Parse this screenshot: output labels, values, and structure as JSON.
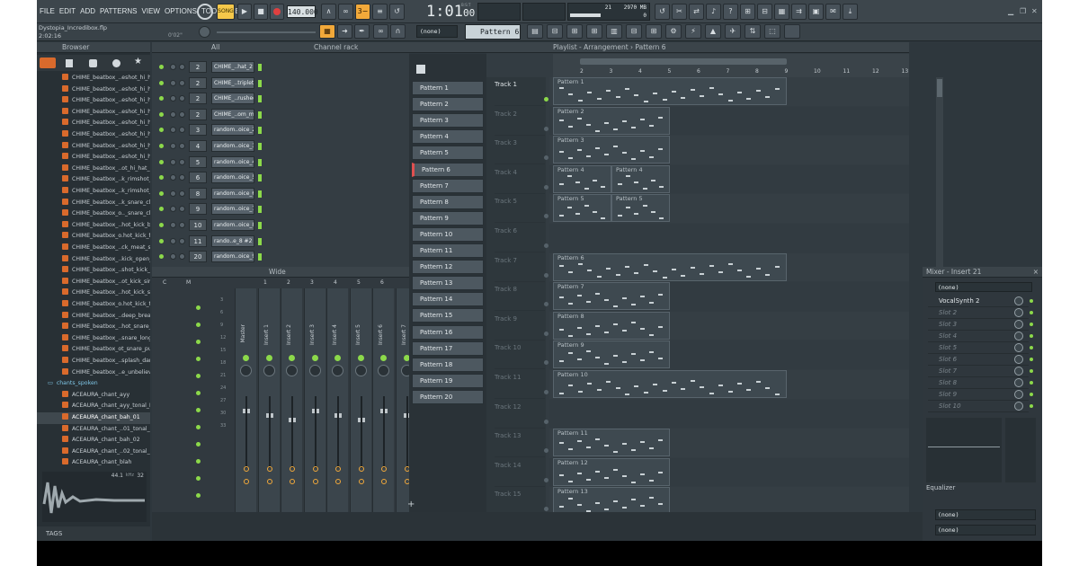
{
  "menu": [
    "FILE",
    "EDIT",
    "ADD",
    "PATTERNS",
    "VIEW",
    "OPTIONS",
    "TOOLS",
    "HELP"
  ],
  "transport": {
    "mode": "SONG",
    "tempo": "140.000",
    "time": "1:01",
    "time_ms": "00",
    "bst": "B:S:T"
  },
  "monitor": {
    "cpu": "21",
    "memory": "2970 MB",
    "voices": "0"
  },
  "project": {
    "file": "Dystopia_Incredibox.flp",
    "length": "2:02:16",
    "offset": "0'02\""
  },
  "toolbar": {
    "pattern_selector": "Pattern 6",
    "snap": "(none)"
  },
  "browser": {
    "title": "Browser",
    "filter": "All",
    "items": [
      "CHIME_beatbox_..eshot_hi_hat_1",
      "CHIME_beatbox_..eshot_hi_hat_2",
      "CHIME_beatbox_..eshot_hi_hat_3",
      "CHIME_beatbox_..eshot_hi_hat_4",
      "CHIME_beatbox_..eshot_hi_hat_5",
      "CHIME_beatbox_..eshot_hi_hat_6",
      "CHIME_beatbox_..eshot_hi_hat_7",
      "CHIME_beatbox_..eshot_hi_hat_8",
      "CHIME_beatbox_..ot_hi_hat_open",
      "CHIME_beatbox_..k_rimshot_airy",
      "CHIME_beatbox_..k_rimshot_wide",
      "CHIME_beatbox_..k_snare_clacky",
      "CHIME_beatbox_o.._snare_classic",
      "CHIME_beatbox_..hot_kick_breath",
      "CHIME_beatbox_o.hot_kick_fluffy",
      "CHIME_beatbox_..ck_meat_shield",
      "CHIME_beatbox_..kick_open_hat",
      "CHIME_beatbox_..shot_kick_shhh",
      "CHIME_beatbox_..ot_kick_simple",
      "CHIME_beatbox_..hot_kick_splash",
      "CHIME_beatbox_o.hot_kick_tight",
      "CHIME_beatbox_..deep_breathy",
      "CHIME_beatbox_..hot_snare_fizzy",
      "CHIME_beatbox_..snare_long_tail",
      "CHIME_beatbox_ot_snare_punch",
      "CHIME_beatbox_..splash_damage",
      "CHIME_beatbox_..e_unbelievable"
    ],
    "folder": "chants_spoken",
    "subitems": [
      "ACEAURA_chant_ayy",
      "ACEAURA_chant_ayy_tonal_Fmin",
      "ACEAURA_chant_bah_01",
      "ACEAURA_chant_..01_tonal_Fmin",
      "ACEAURA_chant_bah_02",
      "ACEAURA_chant_..02_tonal_Fmin",
      "ACEAURA_chant_blah"
    ],
    "selected_sub": 2,
    "sample_info": "44.1",
    "sample_khz": "kHz",
    "sample_bits": "32",
    "tags": "TAGS"
  },
  "channel_rack": {
    "title": "Channel rack",
    "filter": "All",
    "channels": [
      {
        "num": "2",
        "name": "CHIME_..hat_2"
      },
      {
        "num": "2",
        "name": "CHIME_..triplet"
      },
      {
        "num": "2",
        "name": "CHIME_..rushed"
      },
      {
        "num": "2",
        "name": "CHIME_..om_mid"
      },
      {
        "num": "3",
        "name": "random..oice_2"
      },
      {
        "num": "4",
        "name": "random..oice_3"
      },
      {
        "num": "5",
        "name": "random..oice_4"
      },
      {
        "num": "6",
        "name": "random..oice_5"
      },
      {
        "num": "8",
        "name": "random..oice_6"
      },
      {
        "num": "9",
        "name": "random..oice_7"
      },
      {
        "num": "10",
        "name": "random..oice_8"
      },
      {
        "num": "11",
        "name": "rando..e_8 #2"
      },
      {
        "num": "20",
        "name": "random..oice_9"
      }
    ]
  },
  "mixer": {
    "view": "Wide",
    "strips": [
      "C",
      "M",
      "1",
      "2",
      "3",
      "4",
      "5",
      "6"
    ],
    "channels": [
      "Master",
      "Insert 1",
      "Insert 2",
      "Insert 3",
      "Insert 4",
      "Insert 5",
      "Insert 6",
      "Insert 7"
    ],
    "scale": [
      "3",
      "6",
      "9",
      "12",
      "15",
      "18",
      "21",
      "24",
      "27",
      "30",
      "33"
    ]
  },
  "patterns": [
    "Pattern 1",
    "Pattern 2",
    "Pattern 3",
    "Pattern 4",
    "Pattern 5",
    "Pattern 6",
    "Pattern 7",
    "Pattern 8",
    "Pattern 9",
    "Pattern 10",
    "Pattern 11",
    "Pattern 12",
    "Pattern 13",
    "Pattern 14",
    "Pattern 15",
    "Pattern 16",
    "Pattern 17",
    "Pattern 18",
    "Pattern 19",
    "Pattern 20"
  ],
  "selected_pattern": 5,
  "playlist": {
    "title": "Playlist - Arrangement",
    "pattern": "Pattern 6",
    "bars": [
      "2",
      "3",
      "4",
      "5",
      "6",
      "7",
      "8",
      "9",
      "10",
      "11",
      "12",
      "13"
    ],
    "tracks": [
      "Track 1",
      "Track 2",
      "Track 3",
      "Track 4",
      "Track 5",
      "Track 6",
      "Track 7",
      "Track 8",
      "Track 9",
      "Track 10",
      "Track 11",
      "Track 12",
      "Track 13",
      "Track 14",
      "Track 15"
    ],
    "clips": [
      {
        "track": 0,
        "start": 1,
        "len": 8,
        "label": "Pattern 1"
      },
      {
        "track": 1,
        "start": 1,
        "len": 4,
        "label": "Pattern 2"
      },
      {
        "track": 2,
        "start": 1,
        "len": 4,
        "label": "Pattern 3"
      },
      {
        "track": 3,
        "start": 1,
        "len": 2,
        "label": "Pattern 4"
      },
      {
        "track": 3,
        "start": 3,
        "len": 2,
        "label": "Pattern 4"
      },
      {
        "track": 4,
        "start": 1,
        "len": 2,
        "label": "Pattern 5"
      },
      {
        "track": 4,
        "start": 3,
        "len": 2,
        "label": "Pattern 5"
      },
      {
        "track": 6,
        "start": 1,
        "len": 8,
        "label": "Pattern 6"
      },
      {
        "track": 7,
        "start": 1,
        "len": 4,
        "label": "Pattern 7"
      },
      {
        "track": 8,
        "start": 1,
        "len": 4,
        "label": "Pattern 8"
      },
      {
        "track": 9,
        "start": 1,
        "len": 4,
        "label": "Pattern 9"
      },
      {
        "track": 10,
        "start": 1,
        "len": 8,
        "label": "Pattern 10"
      },
      {
        "track": 12,
        "start": 1,
        "len": 4,
        "label": "Pattern 11"
      },
      {
        "track": 13,
        "start": 1,
        "len": 4,
        "label": "Pattern 12"
      },
      {
        "track": 14,
        "start": 1,
        "len": 4,
        "label": "Pattern 13"
      }
    ]
  },
  "mixer_insert": {
    "title": "Mixer - Insert 21",
    "input": "(none)",
    "slots": [
      "VocalSynth 2",
      "Slot 2",
      "Slot 3",
      "Slot 4",
      "Slot 5",
      "Slot 6",
      "Slot 7",
      "Slot 8",
      "Slot 9",
      "Slot 10"
    ],
    "eq_label": "Equalizer",
    "out1": "(none)",
    "out2": "(none)"
  },
  "colors": {
    "accent": "#8cd94a",
    "clip": "#3e4950",
    "orange": "#d96a2c"
  }
}
